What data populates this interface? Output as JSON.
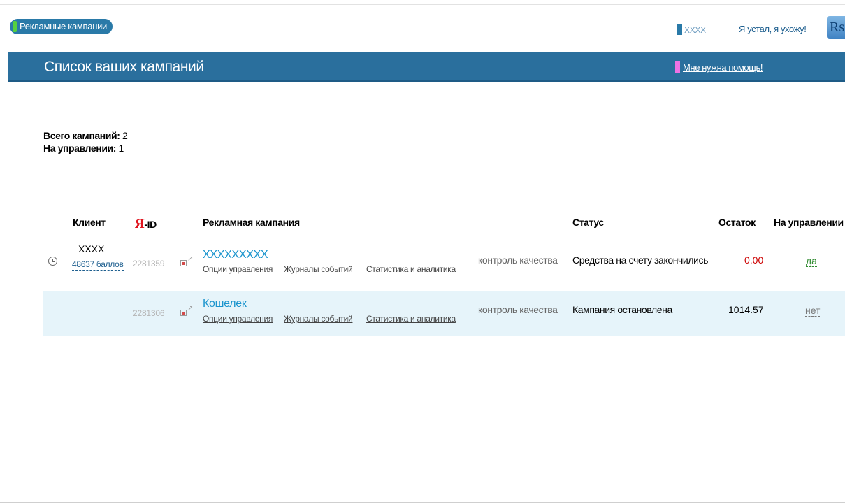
{
  "topbar": {
    "section_tab": "Рекламные кампании",
    "user_name": "XXXX",
    "logout_label": "Я устал, я ухожу!",
    "logo_text": "Rs"
  },
  "header": {
    "title": "Список ваших кампаний",
    "help_label": "Мне нужна помощь!"
  },
  "summary": {
    "total_label": "Всего кампаний:",
    "total_value": "2",
    "managed_label": "На управлении:",
    "managed_value": "1"
  },
  "table": {
    "headers": {
      "client": "Клиент",
      "ya_id_logo": "Я",
      "ya_id_suffix": "-ID",
      "campaign": "Рекламная кампания",
      "status": "Статус",
      "balance": "Остаток",
      "managed": "На управлении"
    },
    "rows": [
      {
        "client_name": "XXXX",
        "client_points": "48637 баллов",
        "ya_id": "2281359",
        "campaign_name": "XXXXXXXXX",
        "link_options": "Опции управления",
        "link_logs": "Журналы событий",
        "link_stats": "Статистика и аналитика",
        "quality": "контроль качества",
        "status": "Средства на счету закончились",
        "balance": "0.00",
        "managed": "да"
      },
      {
        "ya_id": "2281306",
        "campaign_name": "Кошелек",
        "link_options": "Опции управления",
        "link_logs": "Журналы событий",
        "link_stats": "Статистика и аналитика",
        "quality": "контроль качества",
        "status": "Кампания остановлена",
        "balance": "1014.57",
        "managed": "нет"
      }
    ]
  },
  "colors": {
    "header_band": "#2a6f9d",
    "tab_mark": "#56d13e",
    "help_mark": "#ee72e4",
    "row_highlight": "#e6f4fa",
    "balance_negative": "#cc0000",
    "managed_yes": "#2f8a2f",
    "managed_no": "#777777"
  },
  "icons": [
    "clock-icon",
    "external-link-icon"
  ]
}
